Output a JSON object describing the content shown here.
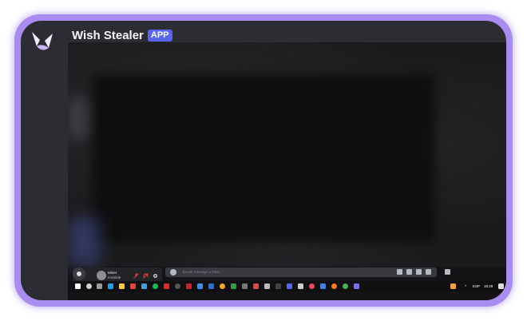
{
  "app": {
    "title": "Wish Stealer",
    "badge": "APP",
    "accent": "#5865f2",
    "frame_color": "#a98cf0"
  },
  "voice_panel": {
    "username": "Miner",
    "status": "Invisible",
    "icons": [
      "microphone-muted-icon",
      "headset-muted-icon",
      "gear-icon"
    ]
  },
  "message_bar": {
    "placeholder": "Enviar mensaje a #test"
  },
  "taskbar": {
    "language": "ESP",
    "time": "16:29"
  }
}
